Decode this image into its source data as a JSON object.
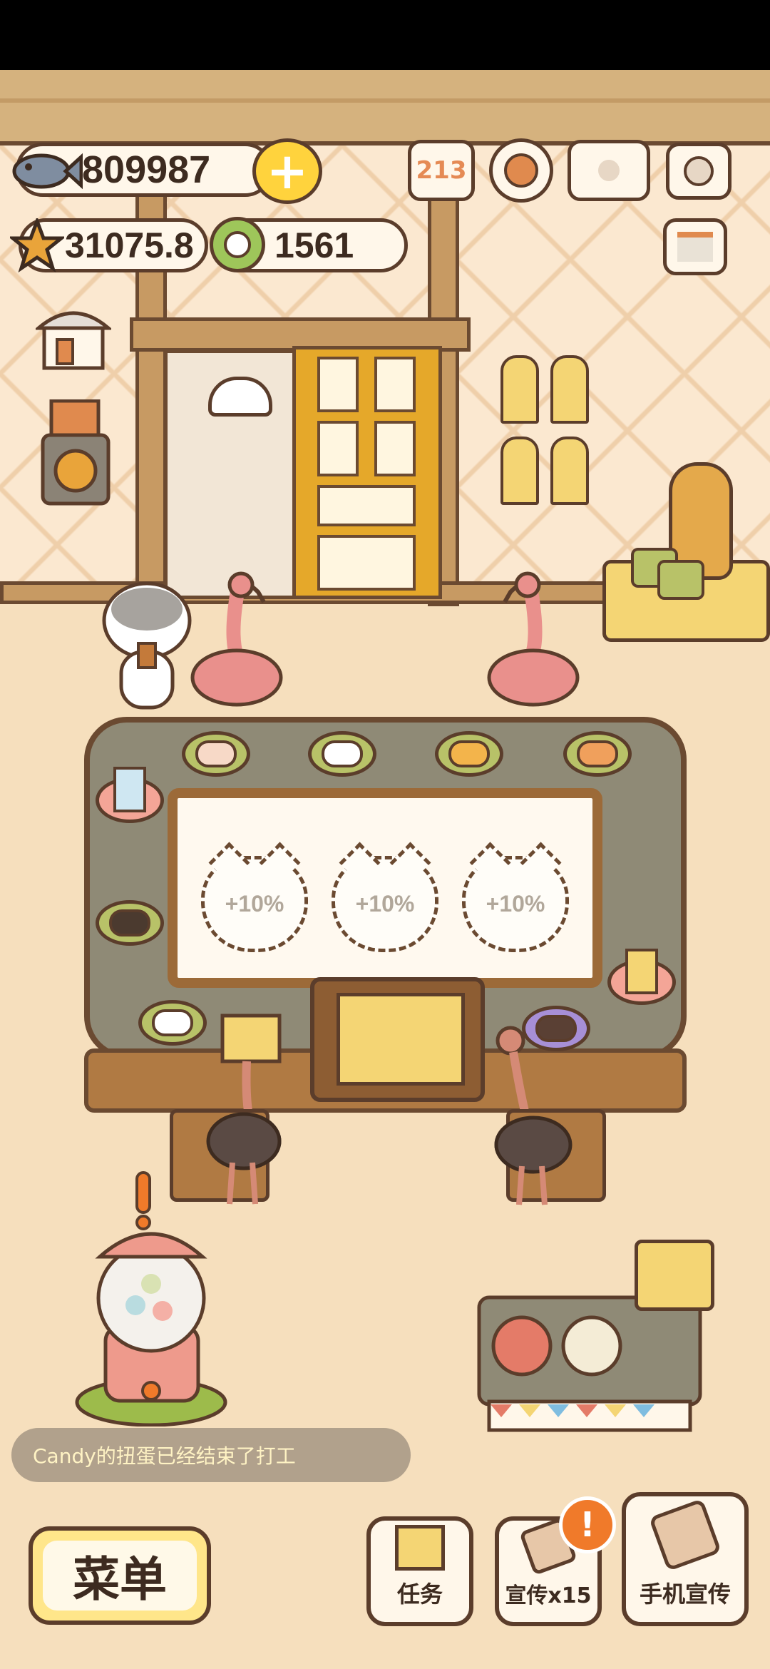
{
  "resources": {
    "fish": "809987",
    "stars": "31075.8",
    "coins": "1561"
  },
  "slots": [
    {
      "bonus": "+10%"
    },
    {
      "bonus": "+10%"
    },
    {
      "bonus": "+10%"
    }
  ],
  "notification": {
    "text": "Candy的扭蛋已经结束了打工"
  },
  "buttons": {
    "menu": "菜单",
    "tasks": "任务",
    "promote": "宣传x15",
    "phone_promote": "手机宣传",
    "promote_alert": "!"
  },
  "icons": {
    "add": "+",
    "rank_digits": "213"
  },
  "colors": {
    "accent_yellow": "#ffd33d",
    "alert_orange": "#f07a2a",
    "outline": "#5b3d2b"
  }
}
